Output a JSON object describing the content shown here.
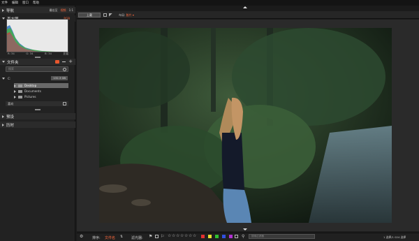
{
  "menu": [
    "文件",
    "编辑",
    "窗口",
    "帮助"
  ],
  "navigator": {
    "title": "导航",
    "options": [
      "最佳至",
      "视频",
      "1:1"
    ],
    "active_option": "视频"
  },
  "histogram": {
    "title": "直方图",
    "mode": "RGB",
    "stats": [
      "R: 34",
      "G: 34",
      "B: 34"
    ],
    "extra": "显著"
  },
  "folders": {
    "title": "文件夹",
    "search_placeholder": "搜索",
    "drive_label": "C:",
    "drive_size": "132.3 GB",
    "items": [
      "Desktop",
      "Documents",
      "Pictures"
    ],
    "favorites_label": "喜欢"
  },
  "panels": [
    {
      "label": "预设"
    },
    {
      "label": "历时"
    }
  ],
  "toolbar": {
    "import_label": "上载",
    "layout_label": "布局:",
    "layout_value": "胶片"
  },
  "bottombar": {
    "sort_label": "排序:",
    "sort_value": "文件名",
    "filter_label": "滤光器:",
    "search_placeholder": "搜索过滤器",
    "status": "1 选择/1 024 选择"
  },
  "colors": {
    "accent": "#ff6a3d",
    "swatches": [
      "#e23030",
      "#e8e030",
      "#30c030",
      "#3050e0",
      "#b030d0"
    ]
  }
}
